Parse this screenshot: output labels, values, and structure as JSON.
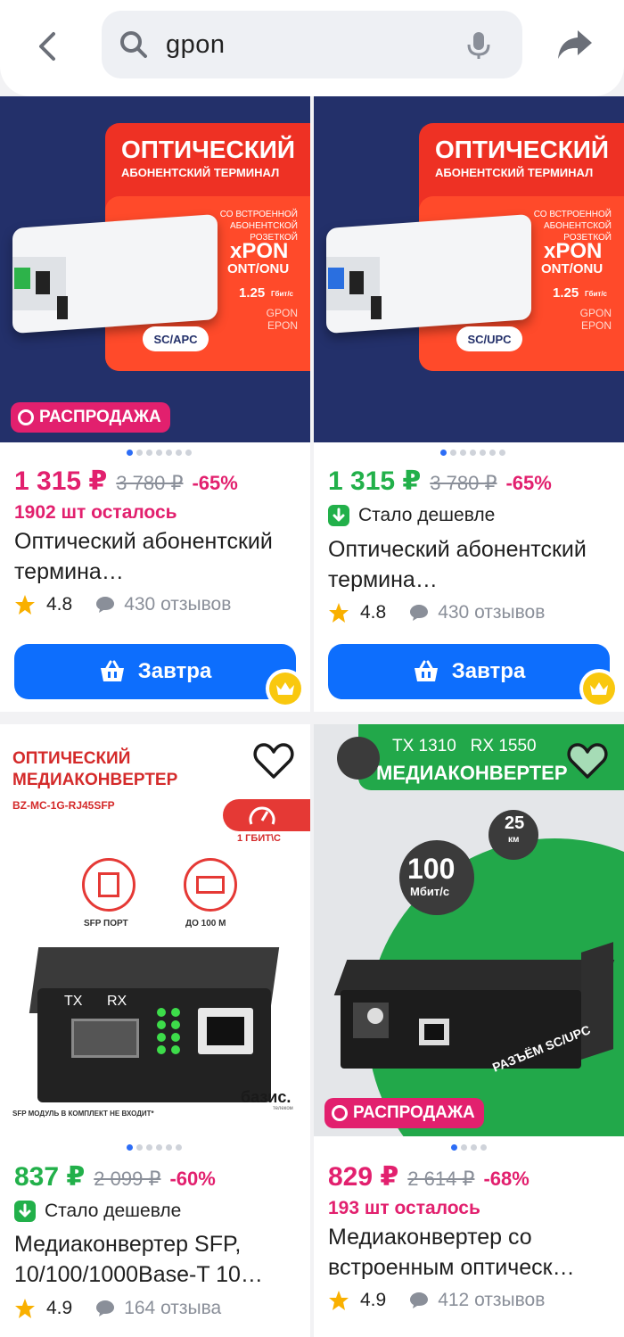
{
  "header": {
    "search_query": "gpon"
  },
  "icons": {
    "back": "chevron-left-icon",
    "search": "search-icon",
    "mic": "microphone-icon",
    "share": "share-arrow-icon",
    "star": "star-icon",
    "reviews": "chat-bubble-icon",
    "cart": "basket-icon",
    "crown": "crown-icon",
    "heart": "heart-icon",
    "cheaper": "arrow-down-icon"
  },
  "colors": {
    "accent": "#0d6efd",
    "sale": "#e2206e",
    "price_green": "#22b04a",
    "star": "#f9b000"
  },
  "products": [
    {
      "price": "1 315 ₽",
      "old_price": "3 780 ₽",
      "discount": "-65%",
      "stock": "1902 шт осталось",
      "title": "Оптический абонентский термина…",
      "rating": "4.8",
      "reviews": "430 отзывов",
      "buy_label": "Завтра",
      "sale_badge": "РАСПРОДАЖА",
      "image": {
        "headline": "ОПТИЧЕСКИЙ",
        "subhead": "АБОНЕНТСКИЙ ТЕРМИНАЛ",
        "note": "СО ВСТРОЕННОЙ АБОНЕНТСКОЙ РОЗЕТКОЙ",
        "tech": "xPON",
        "tech2": "ONT/ONU",
        "speed": "1.25",
        "speed_unit": "Гбит/с",
        "modes": "GPON EPON",
        "connector": "SC/APC"
      }
    },
    {
      "price": "1 315 ₽",
      "old_price": "3 780 ₽",
      "discount": "-65%",
      "cheaper": "Стало дешевле",
      "title": "Оптический абонентский термина…",
      "rating": "4.8",
      "reviews": "430 отзывов",
      "buy_label": "Завтра",
      "image": {
        "headline": "ОПТИЧЕСКИЙ",
        "subhead": "АБОНЕНТСКИЙ ТЕРМИНАЛ",
        "note": "СО ВСТРОЕННОЙ АБОНЕНТСКОЙ РОЗЕТКОЙ",
        "tech": "xPON",
        "tech2": "ONT/ONU",
        "speed": "1.25",
        "speed_unit": "Гбит/с",
        "modes": "GPON EPON",
        "connector": "SC/UPC"
      }
    },
    {
      "price": "837 ₽",
      "old_price": "2 099 ₽",
      "discount": "-60%",
      "cheaper": "Стало дешевле",
      "title": "Медиаконвертер SFP, 10/100/1000Base-T 10…",
      "rating": "4.9",
      "reviews": "164 отзыва",
      "image": {
        "headline1": "ОПТИЧЕСКИЙ",
        "headline2": "МЕДИАКОНВЕРТЕР",
        "model": "BZ-MC-1G-RJ45SFP",
        "speed": "1 ГБИТ\\С",
        "sfp_label": "SFP ПОРТ",
        "distance_label": "ДО 100 М",
        "port_tx": "TX",
        "port_rx": "RX",
        "brand": "базис.",
        "brand_sub": "телеком",
        "footnote": "SFP МОДУЛЬ В КОМПЛЕКТ НЕ ВХОДИТ*"
      }
    },
    {
      "price": "829 ₽",
      "old_price": "2 614 ₽",
      "discount": "-68%",
      "stock": "193 шт осталось",
      "title": "Медиаконвертер со встроенным оптическ…",
      "rating": "4.9",
      "reviews": "412 отзывов",
      "sale_badge": "РАСПРОДАЖА",
      "image": {
        "wavelength": "TX 1310   RX 1550",
        "headline": "МЕДИАКОНВЕРТЕР",
        "distance": "25",
        "distance_unit": "км",
        "speed": "100",
        "speed_unit": "Мбит/с",
        "connector": "РАЗЪЁМ SC/UPC"
      }
    }
  ]
}
